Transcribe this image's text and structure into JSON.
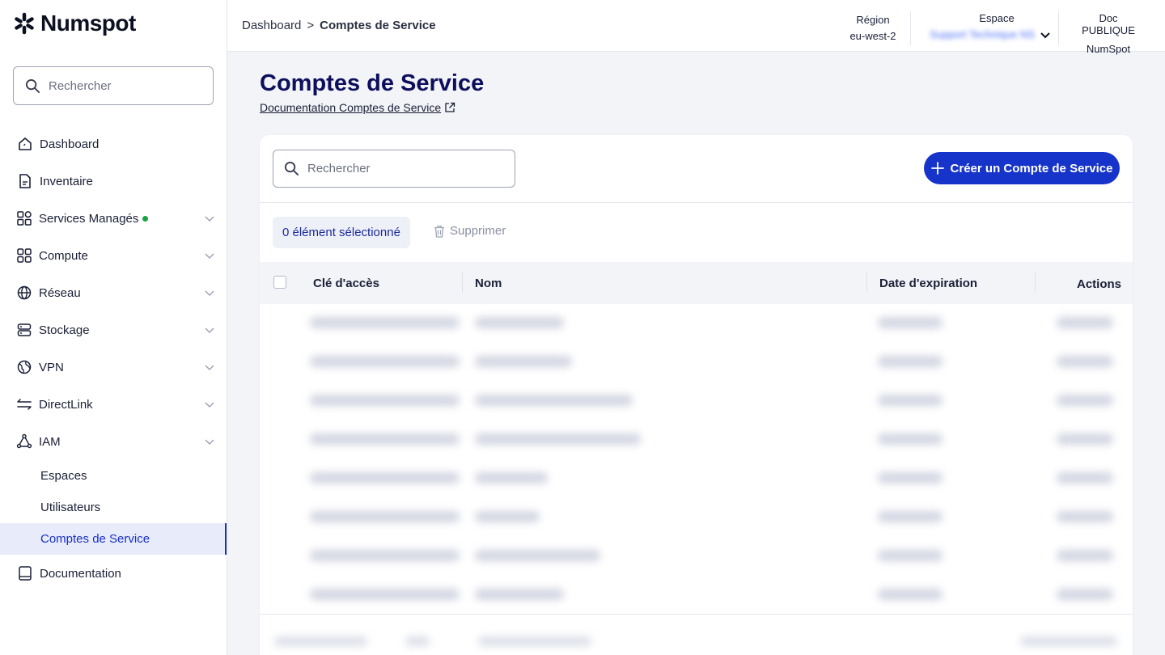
{
  "app": {
    "logo": "Numspot"
  },
  "sidebar": {
    "search_placeholder": "Rechercher",
    "items": [
      {
        "label": "Dashboard",
        "icon": "home-icon",
        "expandable": false
      },
      {
        "label": "Inventaire",
        "icon": "document-icon",
        "expandable": false
      },
      {
        "label": "Services Managés",
        "icon": "grid-icon",
        "expandable": true,
        "status": "active"
      },
      {
        "label": "Compute",
        "icon": "compute-icon",
        "expandable": true
      },
      {
        "label": "Réseau",
        "icon": "globe-icon",
        "expandable": true
      },
      {
        "label": "Stockage",
        "icon": "storage-icon",
        "expandable": true
      },
      {
        "label": "VPN",
        "icon": "vpn-globe-icon",
        "expandable": true
      },
      {
        "label": "DirectLink",
        "icon": "arrows-icon",
        "expandable": true
      },
      {
        "label": "IAM",
        "icon": "iam-icon",
        "expandable": true,
        "expanded": true
      }
    ],
    "iam_sub": [
      "Espaces",
      "Utilisateurs",
      "Comptes de Service"
    ],
    "active_sub": "Comptes de Service",
    "documentation": "Documentation"
  },
  "header": {
    "breadcrumb": [
      "Dashboard",
      ">",
      "Comptes de Service"
    ],
    "region_label": "Région",
    "region_value": "eu-west-2",
    "space_label": "Espace",
    "space_value": "Support Technique NS",
    "doc_label": "Doc PUBLIQUE",
    "doc_value": "NumSpot"
  },
  "main": {
    "title": "Comptes de Service",
    "doc_link": "Documentation Comptes de Service",
    "search_placeholder": "Rechercher",
    "create_button": "Créer un Compte de Service",
    "selected_text": "0 élément sélectionné",
    "delete_button": "Supprimer",
    "columns": [
      "Clé d'accès",
      "Nom",
      "Date d'expiration",
      "Actions"
    ]
  },
  "colors": {
    "accent": "#1634c9",
    "title": "#0d0f5c",
    "status_green": "#19a33f"
  }
}
